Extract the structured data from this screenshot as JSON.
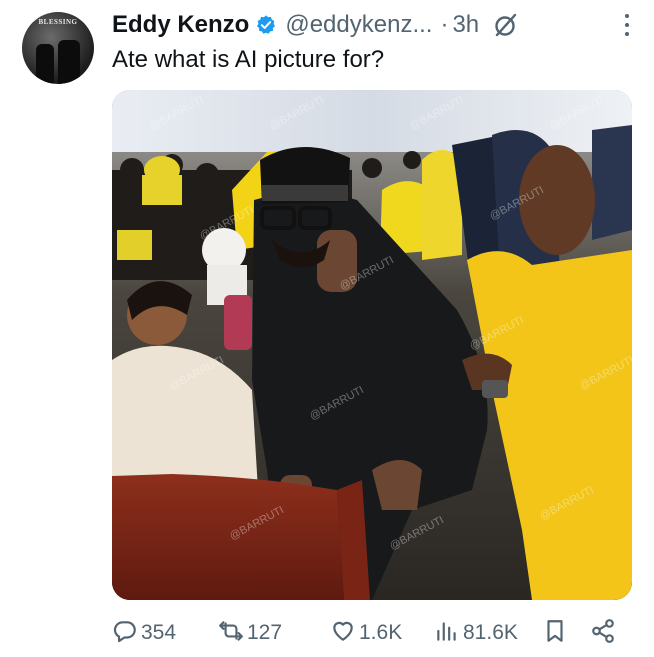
{
  "tweet": {
    "display_name": "Eddy Kenzo",
    "handle": "@eddykenz...",
    "separator": "·",
    "time": "3h",
    "text": "Ate what is AI picture for?",
    "avatar_caption": "BLESSING"
  },
  "media": {
    "watermark": "@BARRUTI"
  },
  "actions": {
    "replies": "354",
    "reposts": "127",
    "likes": "1.6K",
    "views": "81.6K"
  },
  "icons": {
    "verified": "verified-badge-icon",
    "grok": "grok-icon",
    "more": "more-icon",
    "reply": "reply-icon",
    "repost": "repost-icon",
    "like": "heart-icon",
    "views": "views-icon",
    "bookmark": "bookmark-icon",
    "share": "share-icon"
  },
  "colors": {
    "verified": "#1d9bf0",
    "secondary_text": "#536471",
    "primary_text": "#0f1419"
  }
}
